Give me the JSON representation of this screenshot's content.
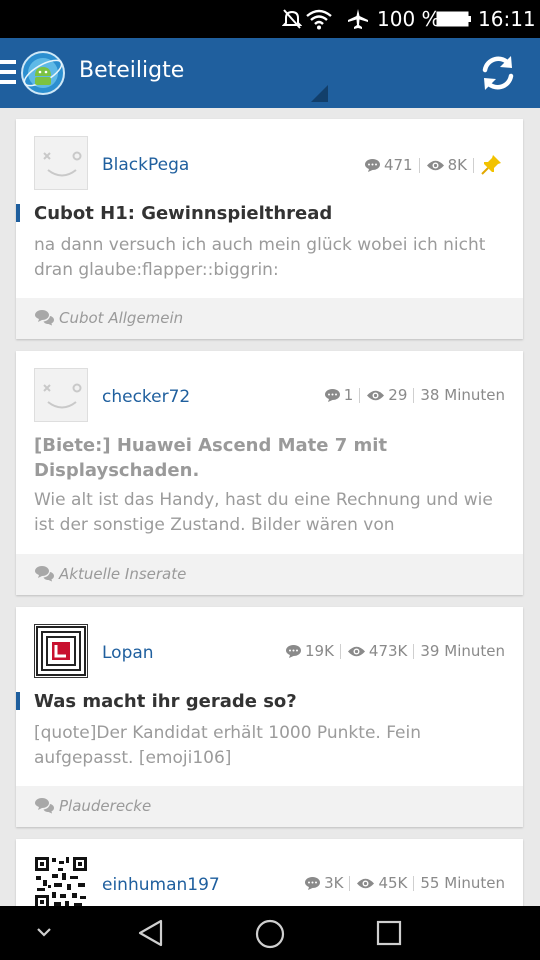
{
  "status_bar": {
    "battery_percent": "100 %",
    "time": "16:11"
  },
  "app_bar": {
    "title": "Beteiligte"
  },
  "threads": [
    {
      "username": "BlackPega",
      "replies": "471",
      "views": "8K",
      "time": "",
      "pinned": true,
      "title": "Cubot H1: Gewinnspielthread",
      "title_read": false,
      "excerpt": "na dann versuch ich auch mein glück wobei ich nicht dran glaube:flapper::biggrin:",
      "forum": "Cubot Allgemein"
    },
    {
      "username": "checker72",
      "replies": "1",
      "views": "29",
      "time": "38 Minuten",
      "pinned": false,
      "title": "[Biete:] Huawei Ascend Mate 7 mit Displayschaden.",
      "title_read": true,
      "excerpt": "Wie alt ist das Handy, hast du eine Rechnung und wie ist der sonstige Zustand. Bilder wären von",
      "forum": "Aktuelle Inserate"
    },
    {
      "username": "Lopan",
      "replies": "19K",
      "views": "473K",
      "time": "39 Minuten",
      "pinned": false,
      "title": "Was macht ihr gerade so?",
      "title_read": false,
      "excerpt": "[quote]Der Kandidat erhält 1000 Punkte.  Fein aufgepasst. [emoji106]",
      "forum": "Plauderecke"
    },
    {
      "username": "einhuman197",
      "replies": "3K",
      "views": "45K",
      "time": "55 Minuten"
    }
  ],
  "colors": {
    "app_bar": "#1f5f9e",
    "link": "#1f5f9e",
    "pin": "#f2c200"
  },
  "icons": [
    "menu-icon",
    "app-logo-icon",
    "refresh-icon",
    "comment-icon",
    "eye-icon",
    "pin-icon",
    "forum-icon",
    "back-icon",
    "home-icon",
    "recents-icon",
    "chevron-down-icon"
  ]
}
